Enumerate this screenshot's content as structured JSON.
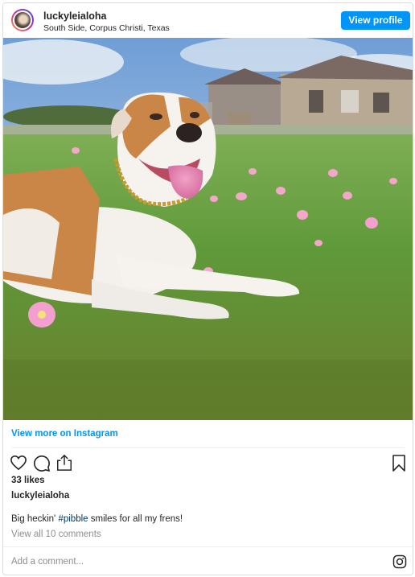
{
  "header": {
    "username": "luckyleialoha",
    "location": "South Side, Corpus Christi, Texas",
    "view_profile_label": "View profile"
  },
  "post": {
    "image_subject": "dog-photo",
    "view_more_label": "View more on Instagram",
    "likes": "33 likes",
    "caption_username": "luckyleialoha",
    "caption_before": "Big heckin' ",
    "caption_hashtag": "#pibble",
    "caption_after": " smiles for all my frens!",
    "view_comments_label": "View all 10 comments",
    "add_comment_placeholder": "Add a comment..."
  },
  "icons": {
    "like": "heart-icon",
    "comment": "comment-icon",
    "share": "share-icon",
    "save": "bookmark-icon",
    "brand": "instagram-icon"
  },
  "colors": {
    "accent": "#0095f6",
    "hashtag": "#00376b",
    "muted": "#8e8e8e",
    "text": "#262626",
    "border": "#dbdbdb"
  }
}
